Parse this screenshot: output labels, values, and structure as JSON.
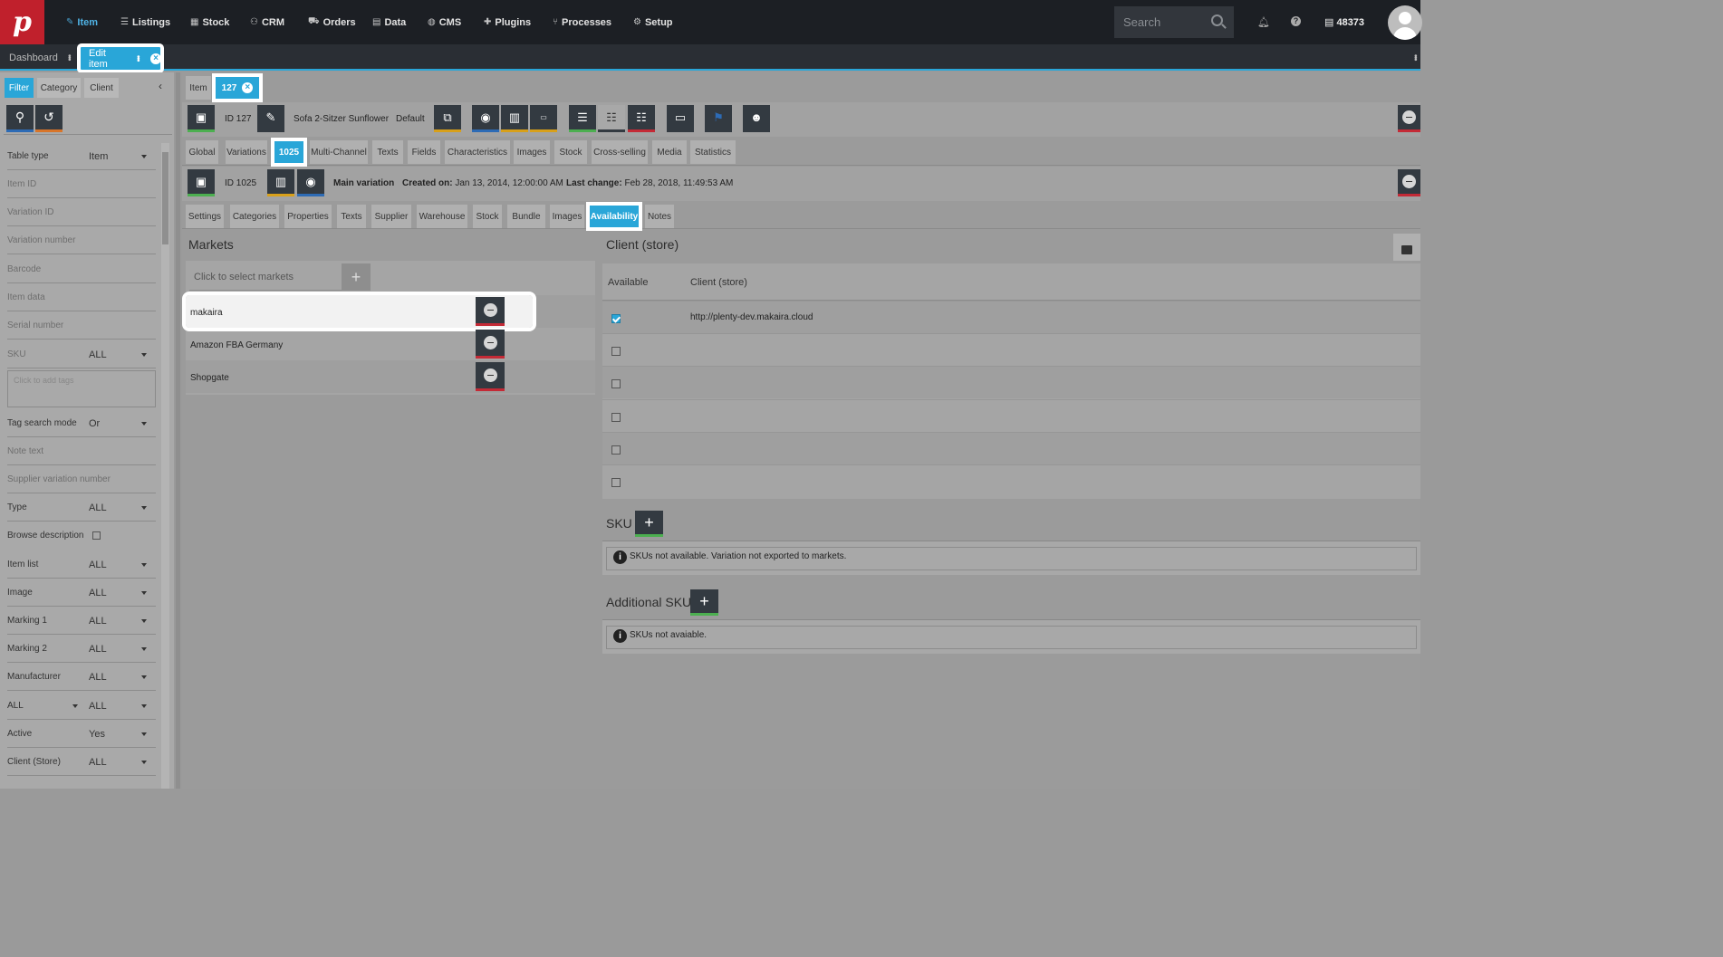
{
  "topbar": {
    "logo": "p",
    "nav": [
      {
        "label": "Item",
        "icon": "tag-icon"
      },
      {
        "label": "Listings",
        "icon": "list-icon"
      },
      {
        "label": "Stock",
        "icon": "boxes-icon"
      },
      {
        "label": "CRM",
        "icon": "users-icon"
      },
      {
        "label": "Orders",
        "icon": "cart-icon"
      },
      {
        "label": "Data",
        "icon": "database-icon"
      },
      {
        "label": "CMS",
        "icon": "globe-icon"
      },
      {
        "label": "Plugins",
        "icon": "puzzle-icon"
      },
      {
        "label": "Processes",
        "icon": "flow-icon"
      },
      {
        "label": "Setup",
        "icon": "gear-icon"
      }
    ],
    "search_placeholder": "Search",
    "user_count": "48373"
  },
  "tabs": {
    "dashboard": "Dashboard",
    "edit_item": "Edit item"
  },
  "sidebar": {
    "tabs": [
      "Filter",
      "Category",
      "Client"
    ],
    "fields": [
      {
        "label": "Table type",
        "value": "Item",
        "select": true
      },
      {
        "label": "Item ID"
      },
      {
        "label": "Variation ID"
      },
      {
        "label": "Variation number"
      },
      {
        "label": "Barcode"
      },
      {
        "label": "Item data"
      },
      {
        "label": "Serial number"
      },
      {
        "label": "SKU",
        "value": "ALL",
        "select": true
      }
    ],
    "tags_placeholder": "Click to add tags",
    "fields2": [
      {
        "label": "Tag search mode",
        "value": "Or",
        "select": true
      },
      {
        "label": "Note text"
      },
      {
        "label": "Supplier variation number"
      },
      {
        "label": "Type",
        "value": "ALL",
        "select": true
      },
      {
        "label": "Browse description",
        "checkbox": true
      },
      {
        "label": "Item list",
        "value": "ALL",
        "select": true
      },
      {
        "label": "Image",
        "value": "ALL",
        "select": true
      },
      {
        "label": "Marking 1",
        "value": "ALL",
        "select": true
      },
      {
        "label": "Marking 2",
        "value": "ALL",
        "select": true
      },
      {
        "label": "Manufacturer",
        "value": "ALL",
        "select": true
      },
      {
        "label": "ALL",
        "value": "ALL",
        "select": true
      },
      {
        "label": "Active",
        "value": "Yes",
        "select": true
      },
      {
        "label": "Client (Store)",
        "value": "ALL",
        "select": true
      }
    ]
  },
  "main": {
    "breadcrumb": {
      "item": "Item",
      "id": "127"
    },
    "item_toolbar": {
      "id_label": "ID",
      "id": "127",
      "name": "Sofa 2-Sitzer Sunflower",
      "default": "Default"
    },
    "item_tabs": [
      "Global",
      "Variations",
      "1025",
      "Multi-Channel",
      "Texts",
      "Fields",
      "Characteristics",
      "Images",
      "Stock",
      "Cross-selling",
      "Media",
      "Statistics"
    ],
    "variation_toolbar": {
      "id_label": "ID",
      "id": "1025",
      "main": "Main variation",
      "created_label": "Created on:",
      "created": "Jan 13, 2014, 12:00:00 AM",
      "changed_label": "Last change:",
      "changed": "Feb 28, 2018, 11:49:53 AM"
    },
    "variation_tabs": [
      "Settings",
      "Categories",
      "Properties",
      "Texts",
      "Supplier",
      "Warehouse",
      "Stock",
      "Bundle",
      "Images",
      "Availability",
      "Notes"
    ],
    "markets": {
      "title": "Markets",
      "placeholder": "Click to select markets",
      "rows": [
        "makaira",
        "Amazon FBA Germany",
        "Shopgate"
      ]
    },
    "client": {
      "title": "Client (store)",
      "col_available": "Available",
      "col_client": "Client (store)",
      "rows": [
        {
          "checked": true,
          "url": "http://plenty-dev.makaira.cloud"
        },
        {
          "checked": false,
          "url": ""
        },
        {
          "checked": false,
          "url": ""
        },
        {
          "checked": false,
          "url": ""
        },
        {
          "checked": false,
          "url": ""
        },
        {
          "checked": false,
          "url": ""
        }
      ]
    },
    "sku": {
      "title": "SKU",
      "info": "SKUs not available. Variation not exported to markets."
    },
    "additional_sku": {
      "title": "Additional SKU",
      "info": "SKUs not avaiable."
    }
  }
}
